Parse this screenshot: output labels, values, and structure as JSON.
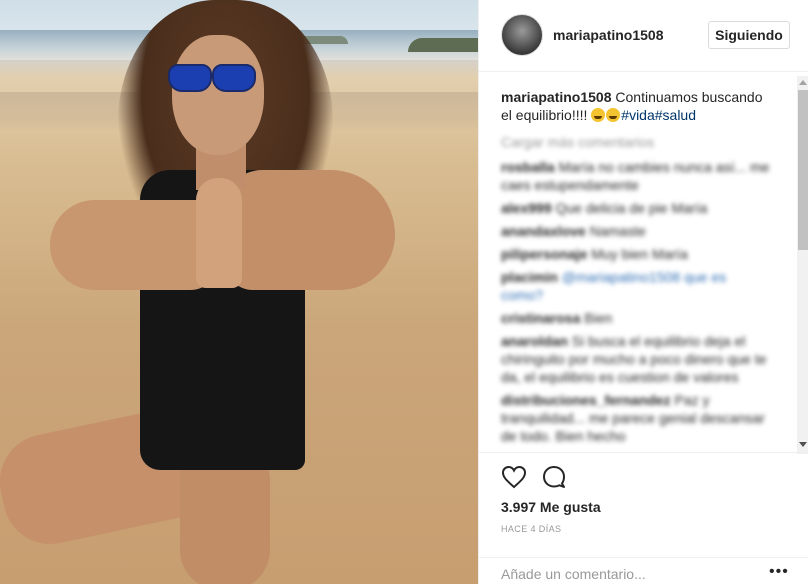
{
  "post": {
    "username": "mariapatino1508",
    "follow_label": "Siguiendo",
    "caption_text": "Continuamos buscando el equilibrio!!!! ",
    "caption_tags": "#vida#salud",
    "load_more": "Cargar más comentarios",
    "comments": [
      {
        "user": "rosballa",
        "text": "María no cambies nunca así... me caes estupendamente"
      },
      {
        "user": "alex999",
        "text": "Que delicia de pie María"
      },
      {
        "user": "anandaxlove",
        "text": "Namaste"
      },
      {
        "user": "pilipersonaje",
        "text": "Muy bien María"
      },
      {
        "user": "placimin",
        "text": "@mariapatino1508 que es como?",
        "link": "@mariapatino1508"
      },
      {
        "user": "cristinarosa",
        "text": "Bien"
      },
      {
        "user": "anaroldan",
        "text": "Si busca el equilibrio deja el chiringuito por mucho a poco dinero que te da, el equilibrio es cuestion de valores"
      },
      {
        "user": "distribuciones_fernandez",
        "text": "Paz y tranquilidad... me parece genial descansar de todo. Bien hecho"
      }
    ],
    "likes": "3.997 Me gusta",
    "time": "HACE 4 DÍAS",
    "add_comment_placeholder": "Añade un comentario...",
    "more_label": "•••"
  },
  "icons": {
    "like": "heart-icon",
    "comment": "comment-icon",
    "options": "more-options-icon"
  },
  "colors": {
    "hashtag": "#003569",
    "muted": "#999999",
    "border": "#efefef",
    "mention": "#2e6db4"
  }
}
